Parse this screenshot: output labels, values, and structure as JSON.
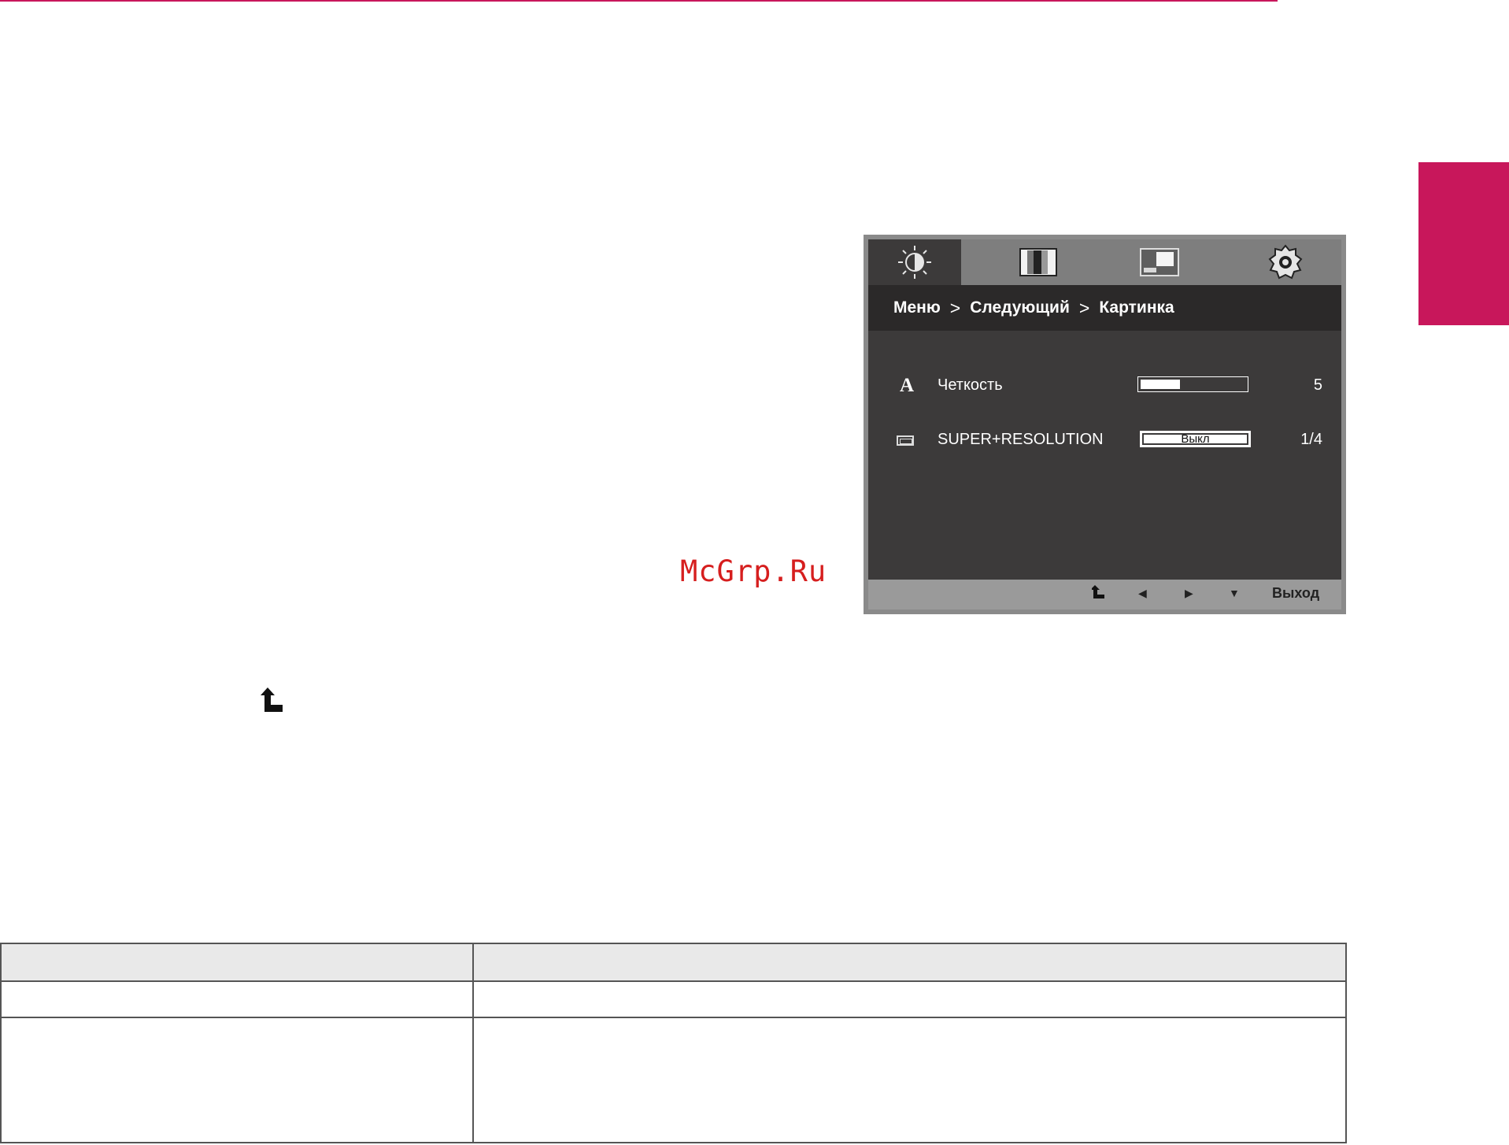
{
  "colors": {
    "accent": "#c8175b",
    "osd_bg": "#3c3a3a",
    "watermark": "#d61e1e"
  },
  "osd": {
    "tabs": [
      {
        "icon": "brightness-icon",
        "active": true
      },
      {
        "icon": "color-bars-icon",
        "active": false
      },
      {
        "icon": "picture-in-picture-icon",
        "active": false
      },
      {
        "icon": "settings-gear-icon",
        "active": false
      }
    ],
    "breadcrumb": {
      "item1": "Меню",
      "sep": ">",
      "item2": "Следующий",
      "item3": "Картинка"
    },
    "rows": [
      {
        "icon": "letter-a-icon",
        "label": "Четкость",
        "bar_level": 0.36,
        "value": "5"
      },
      {
        "icon": "super-resolution-icon",
        "label": "SUPER+RESOLUTION",
        "box_text": "Выкл",
        "value": "1/4"
      }
    ],
    "footer": {
      "exit": "Выход"
    }
  },
  "watermark": "McGrp.Ru",
  "spec_table": {
    "header": [
      "",
      ""
    ],
    "rows": [
      [
        "",
        ""
      ],
      [
        "",
        ""
      ]
    ]
  }
}
